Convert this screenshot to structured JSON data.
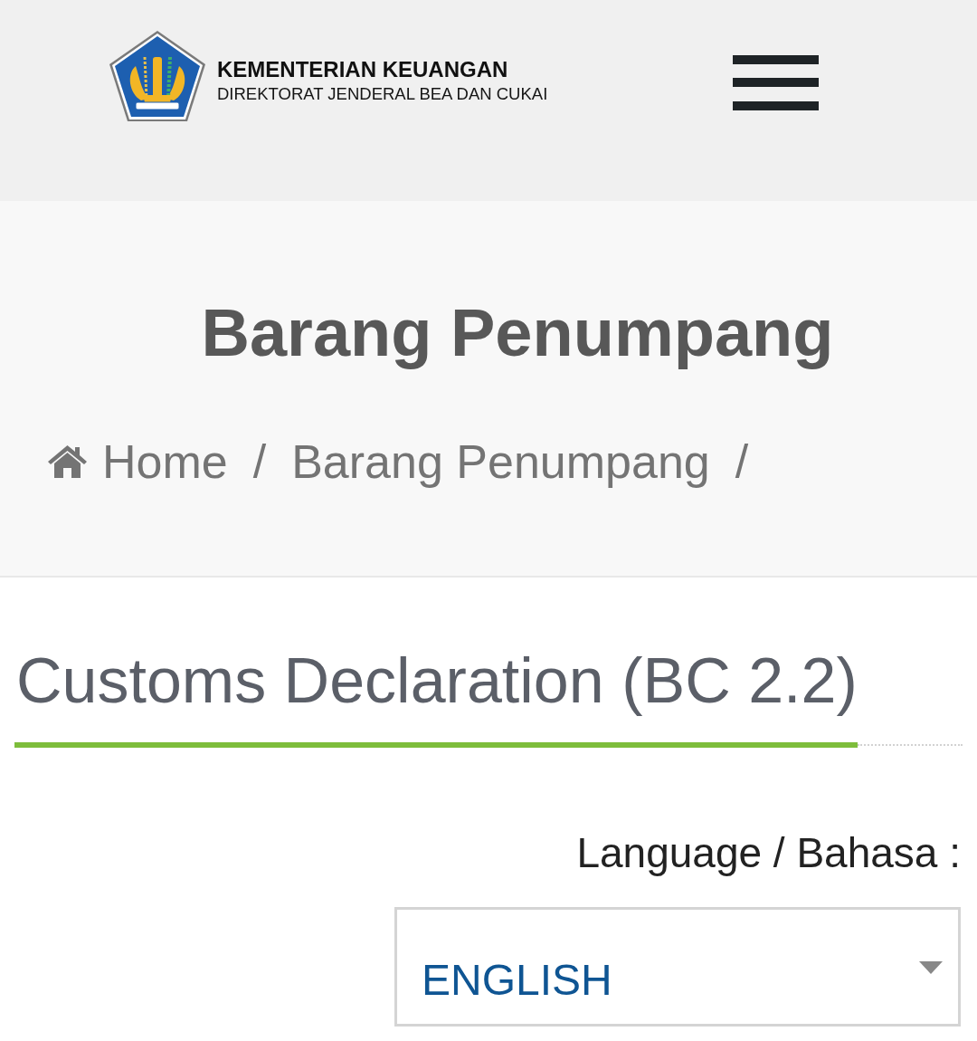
{
  "header": {
    "logo_title": "KEMENTERIAN KEUANGAN",
    "logo_subtitle": "DIREKTORAT JENDERAL BEA DAN CUKAI"
  },
  "hero": {
    "title": "Barang Penumpang",
    "breadcrumb": [
      {
        "kind": "home",
        "label": "Home",
        "separator": "/"
      },
      {
        "kind": "page",
        "label": "Barang Penumpang",
        "separator": "/"
      }
    ]
  },
  "section": {
    "title": "Customs Declaration (BC 2.2)"
  },
  "language": {
    "label": "Language / Bahasa :",
    "value": "ENGLISH"
  }
}
